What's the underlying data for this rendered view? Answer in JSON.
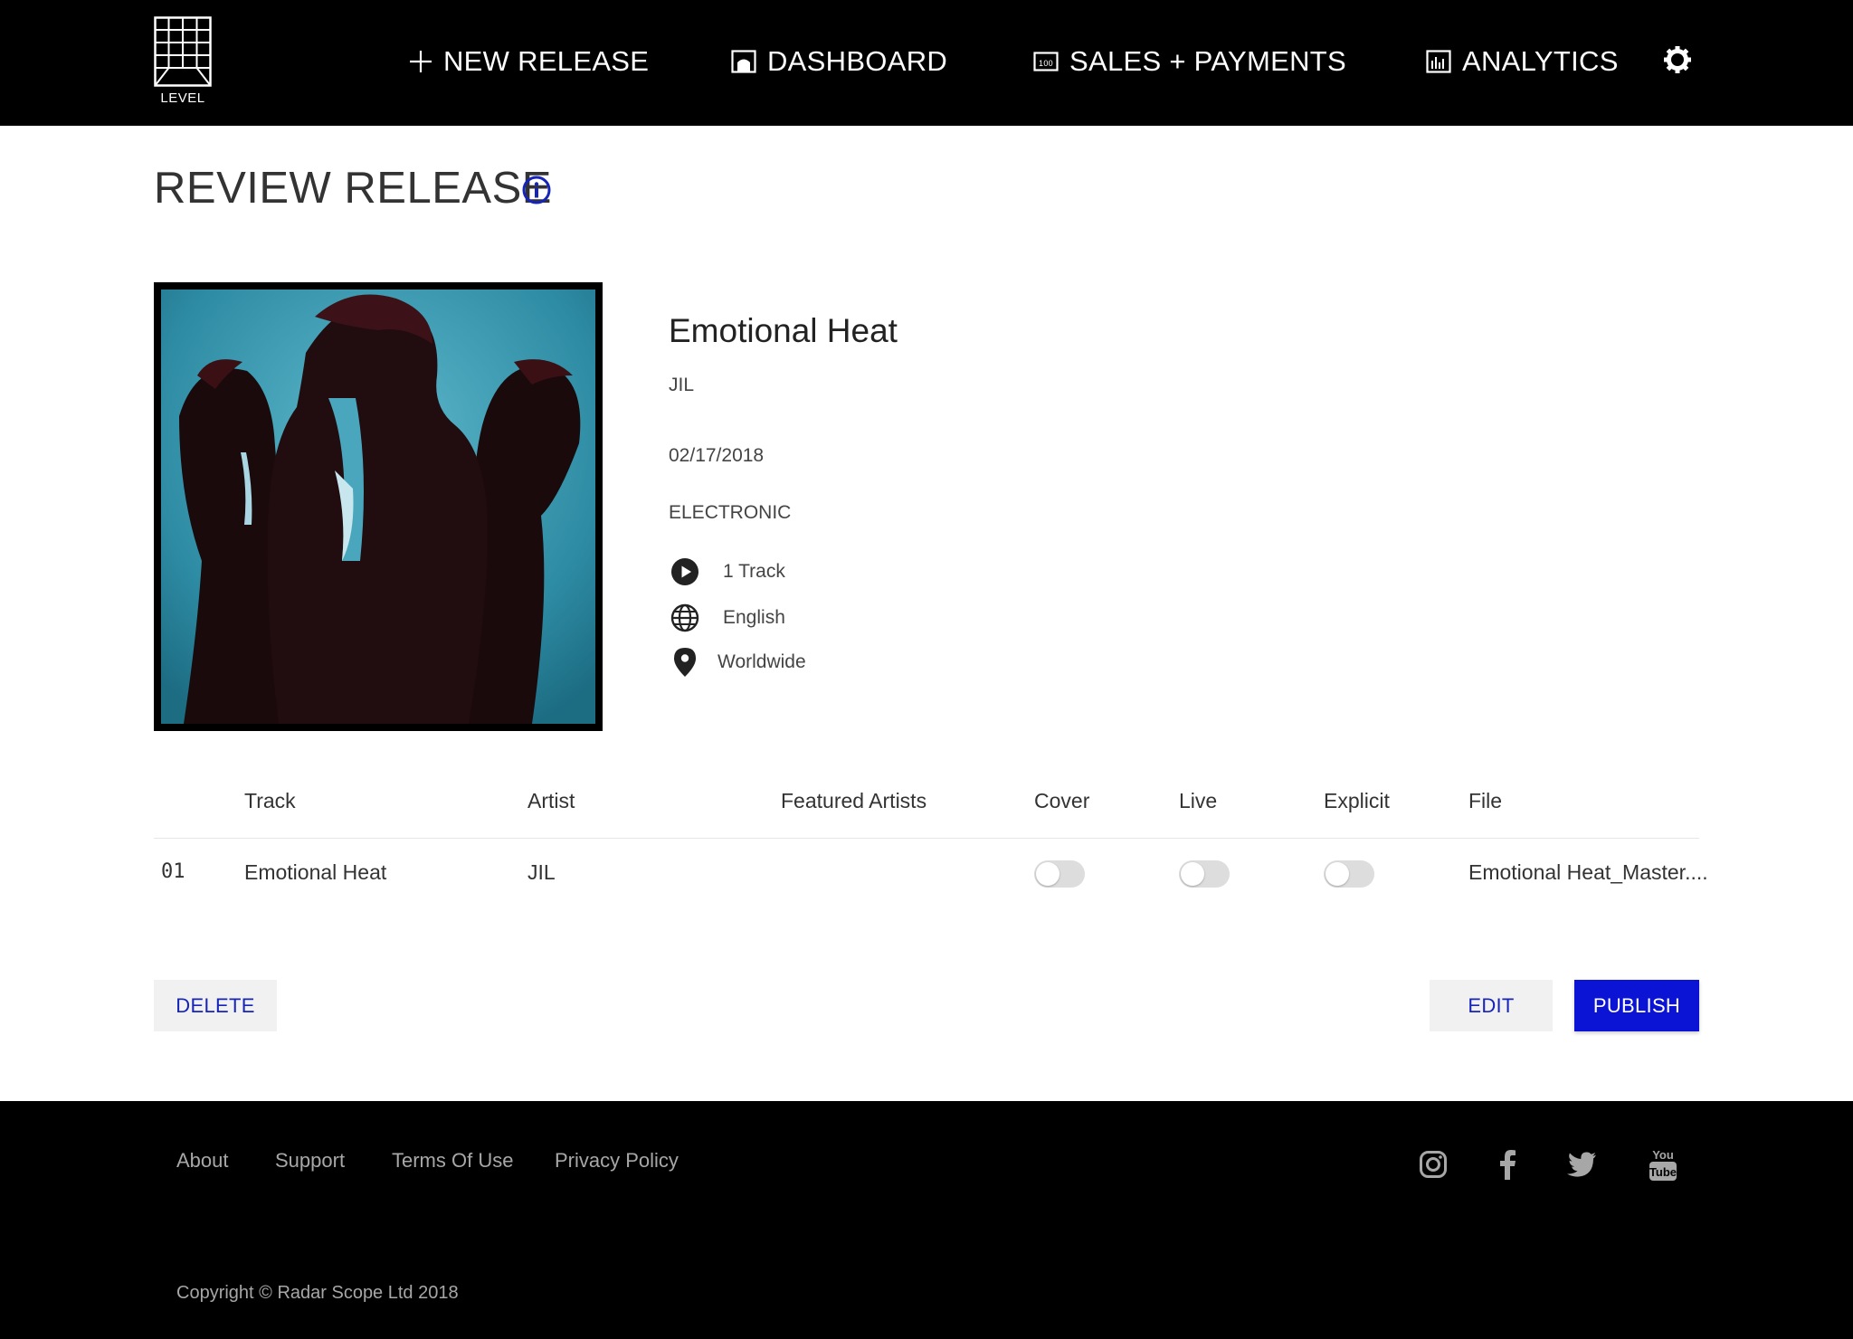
{
  "header": {
    "logo_text": "LEVEL",
    "nav": [
      {
        "label": "NEW RELEASE",
        "icon": "plus-icon"
      },
      {
        "label": "DASHBOARD",
        "icon": "dashboard-icon"
      },
      {
        "label": "SALES + PAYMENTS",
        "icon": "sales-icon"
      },
      {
        "label": "ANALYTICS",
        "icon": "analytics-icon"
      }
    ],
    "settings_icon": "gear-icon"
  },
  "page": {
    "title": "REVIEW RELEASE",
    "info_icon": "info-icon"
  },
  "release": {
    "title": "Emotional Heat",
    "artist": "JIL",
    "date": "02/17/2018",
    "genre": "ELECTRONIC",
    "track_count": "1 Track",
    "language": "English",
    "territory": "Worldwide"
  },
  "table": {
    "headers": [
      "Track",
      "Artist",
      "Featured Artists",
      "Cover",
      "Live",
      "Explicit",
      "File"
    ],
    "rows": [
      {
        "number": "01",
        "track": "Emotional Heat",
        "artist": "JIL",
        "featured": "",
        "cover": false,
        "live": false,
        "explicit": false,
        "file": "Emotional Heat_Master...."
      }
    ]
  },
  "actions": {
    "delete": "DELETE",
    "edit": "EDIT",
    "publish": "PUBLISH"
  },
  "footer": {
    "links": [
      "About",
      "Support",
      "Terms Of Use",
      "Privacy Policy"
    ],
    "social": [
      "instagram-icon",
      "facebook-icon",
      "twitter-icon",
      "youtube-icon"
    ],
    "youtube_text_1": "You",
    "youtube_text_2": "Tube",
    "copyright": "Copyright © Radar Scope Ltd 2018"
  },
  "colors": {
    "header_bg": "#000000",
    "accent_blue": "#0b14d4",
    "link_blue": "#1624b8",
    "footer_text": "#a7a7a7"
  }
}
